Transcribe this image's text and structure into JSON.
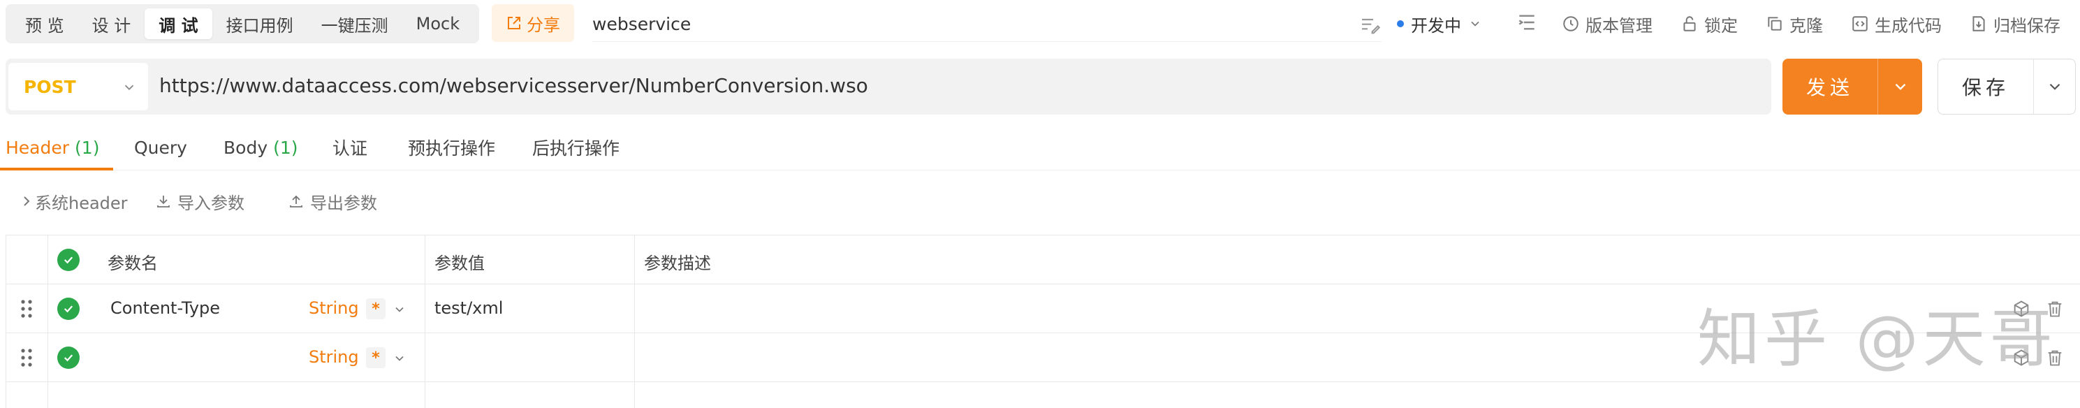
{
  "mode_tabs": [
    {
      "label": "预 览"
    },
    {
      "label": "设 计"
    },
    {
      "label": "调 试"
    },
    {
      "label": "接口用例"
    },
    {
      "label": "一键压测"
    },
    {
      "label": "Mock"
    }
  ],
  "share": {
    "label": "分享"
  },
  "api_name": "webservice",
  "status": {
    "label": "开发中"
  },
  "toolbar_actions": {
    "version": "版本管理",
    "lock": "锁定",
    "clone": "克隆",
    "gen_code": "生成代码",
    "archive": "归档保存"
  },
  "request": {
    "method": "POST",
    "url": "https://www.dataaccess.com/webservicesserver/NumberConversion.wso",
    "send_label": "发送",
    "save_label": "保存"
  },
  "req_tabs": {
    "header": {
      "label": "Header",
      "count": "(1)"
    },
    "query": {
      "label": "Query"
    },
    "body": {
      "label": "Body",
      "count": "(1)"
    },
    "auth": {
      "label": "认证"
    },
    "pre": {
      "label": "预执行操作"
    },
    "post": {
      "label": "后执行操作"
    }
  },
  "sub_toolbar": {
    "system_header": "系统header",
    "import": "导入参数",
    "export": "导出参数"
  },
  "table": {
    "headers": {
      "name": "参数名",
      "value": "参数值",
      "desc": "参数描述"
    },
    "rows": [
      {
        "name": "Content-Type",
        "type": "String",
        "required": "*",
        "value": "test/xml",
        "desc": ""
      },
      {
        "name": "",
        "type": "String",
        "required": "*",
        "value": "",
        "desc": ""
      }
    ]
  },
  "watermark": "知乎 @天哥",
  "colors": {
    "accent": "#f27c0e",
    "send": "#f58220",
    "method": "#f4b400",
    "success": "#2ba84a"
  }
}
